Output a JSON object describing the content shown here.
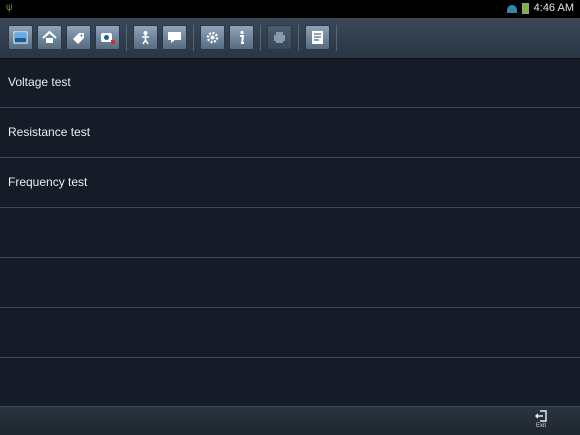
{
  "status_bar": {
    "time": "4:46 AM"
  },
  "toolbar": {
    "icons": [
      "home-screen-icon",
      "home-icon",
      "tag-icon",
      "diagnostics-icon",
      "person-icon",
      "message-icon",
      "settings-icon",
      "info-icon",
      "print-icon",
      "document-icon"
    ]
  },
  "list": {
    "items": [
      "Voltage test",
      "Resistance test",
      "Frequency test",
      "",
      "",
      "",
      ""
    ]
  },
  "bottom_bar": {
    "exit_label": "Exit"
  }
}
